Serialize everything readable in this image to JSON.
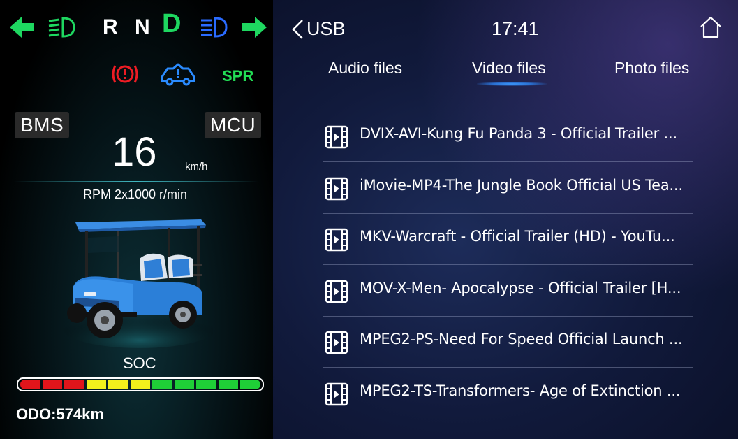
{
  "dashboard": {
    "gears": [
      "R",
      "N",
      "D"
    ],
    "active_gear": "D",
    "indicators": {
      "left_turn_icon": "arrow-left-icon",
      "low_beam_icon": "low-beam-icon",
      "high_beam_icon": "high-beam-icon",
      "right_turn_icon": "arrow-right-icon"
    },
    "warnings": {
      "brake": "brake-warning-icon",
      "cart": "vehicle-fault-icon",
      "spr_label": "SPR"
    },
    "bms_label": "BMS",
    "mcu_label": "MCU",
    "speed": "16",
    "speed_unit": "km/h",
    "rpm": "RPM 2x1000 r/min",
    "soc_label": "SOC",
    "soc_segments": [
      "#e0151b",
      "#e0151b",
      "#e0151b",
      "#f2f11c",
      "#f2f11c",
      "#f2f11c",
      "#1fcf37",
      "#1fcf37",
      "#1fcf37",
      "#1fcf37",
      "#1fcf37"
    ],
    "odo": "ODO:574km"
  },
  "media": {
    "back_label": "USB",
    "time": "17:41",
    "tabs": [
      "Audio files",
      "Video files",
      "Photo files"
    ],
    "active_tab": "Video files",
    "files": [
      "DVIX-AVI-Kung Fu Panda 3 - Official Trailer ...",
      "iMovie-MP4-The Jungle Book Official US Tea...",
      "MKV-Warcraft - Official Trailer (HD) - YouTu...",
      "MOV-X-Men- Apocalypse - Official Trailer [H...",
      "MPEG2-PS-Need For Speed Official Launch ...",
      "MPEG2-TS-Transformers- Age of Extinction ..."
    ]
  },
  "colors": {
    "gear_active": "#1ed760",
    "turn_signal": "#1ed760",
    "low_beam": "#1ed760",
    "high_beam": "#2a6bff",
    "brake_warning": "#ee1c24",
    "vehicle_fault": "#2a8bff",
    "spr": "#22dd55"
  }
}
